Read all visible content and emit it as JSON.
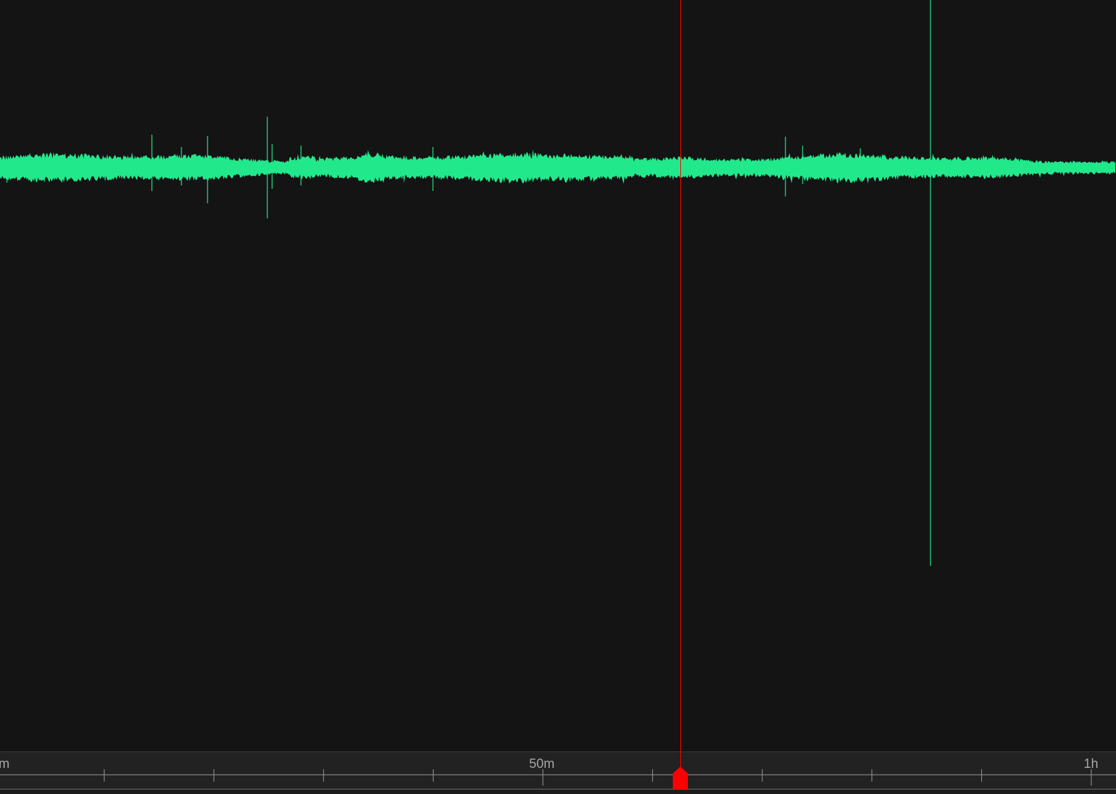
{
  "timeline": {
    "labels": [
      {
        "text": "m"
      },
      {
        "text": "50m"
      },
      {
        "text": "1h"
      }
    ]
  },
  "playhead": {
    "color": "#ff0000",
    "position_minutes": 52.5
  },
  "waveform": {
    "color": "#22e88c",
    "background": "#141414"
  },
  "icons": {
    "playhead_handle": "playhead-marker-icon"
  }
}
